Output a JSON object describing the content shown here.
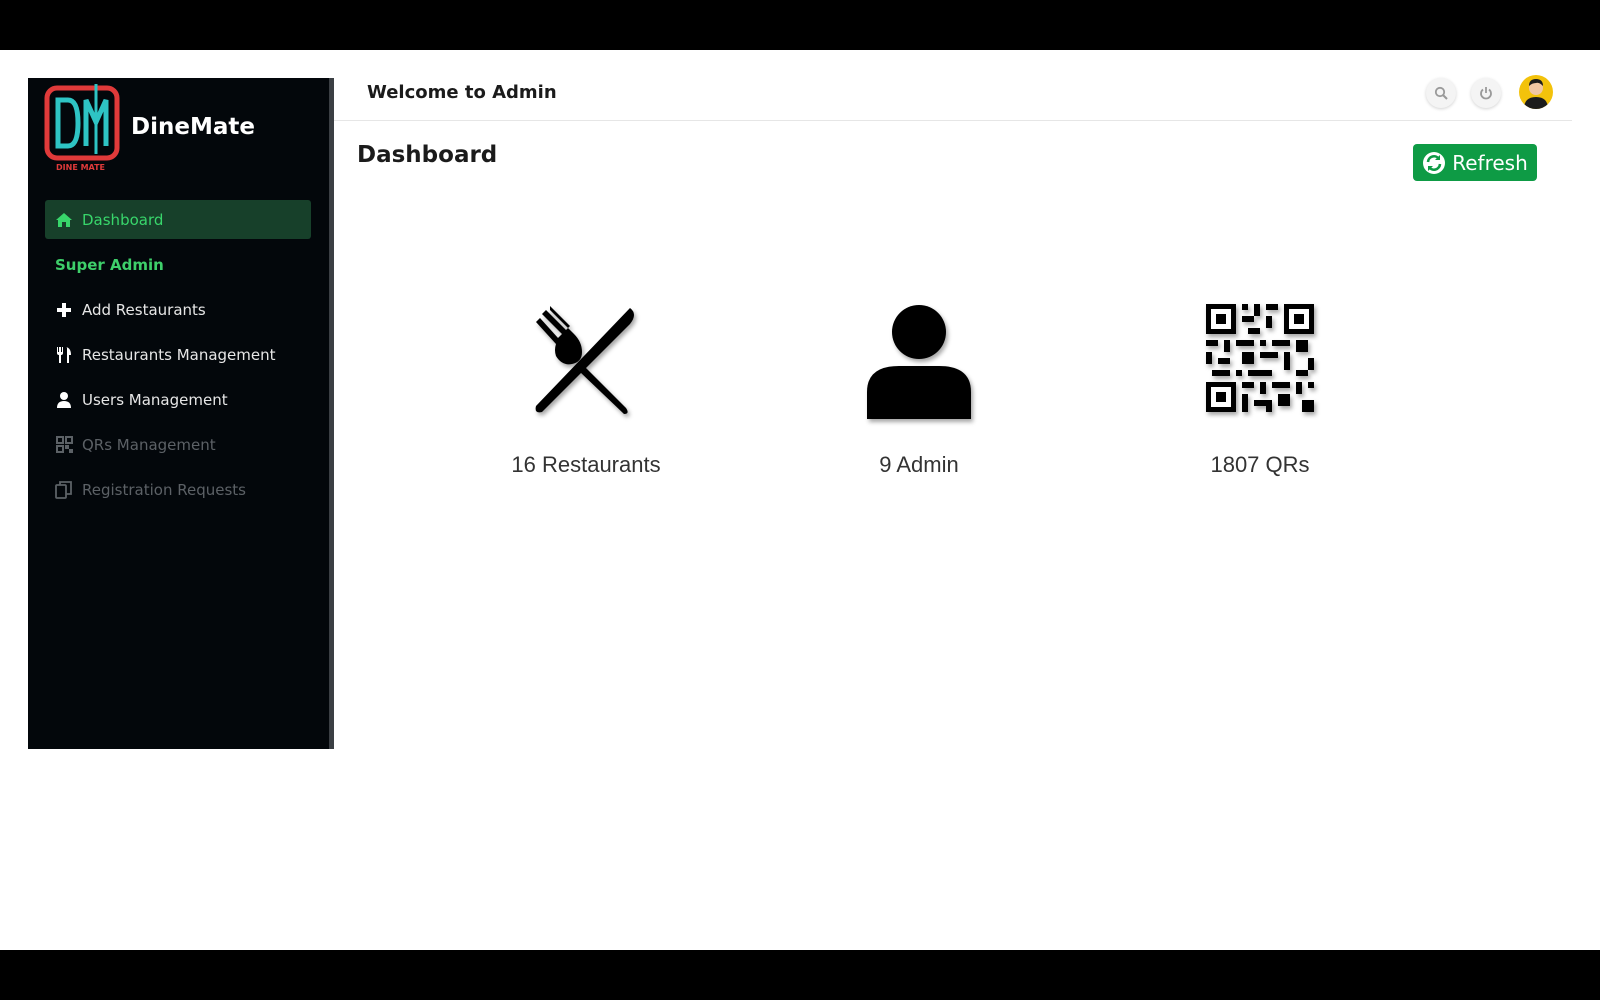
{
  "brand": {
    "name": "DineMate",
    "logo_caption": "DINE MATE",
    "logo_letters": "DM"
  },
  "colors": {
    "sidebar_bg": "#03070b",
    "accent_green": "#0e9b45",
    "active_text": "#38d66b",
    "logo_red": "#e03a3a",
    "logo_teal": "#2ec4c4"
  },
  "sidebar": {
    "items": [
      {
        "label": "Dashboard",
        "icon": "home-icon",
        "state": "active"
      },
      {
        "label": "Super Admin",
        "icon": "",
        "state": "section-header"
      },
      {
        "label": "Add Restaurants",
        "icon": "plus-icon",
        "state": "normal"
      },
      {
        "label": "Restaurants Management",
        "icon": "utensils-icon",
        "state": "normal"
      },
      {
        "label": "Users Management",
        "icon": "user-icon",
        "state": "normal"
      },
      {
        "label": "QRs Management",
        "icon": "qr-icon",
        "state": "disabled"
      },
      {
        "label": "Registration Requests",
        "icon": "copy-icon",
        "state": "disabled"
      }
    ]
  },
  "header": {
    "welcome": "Welcome to Admin",
    "actions": [
      "search-icon",
      "power-icon",
      "user-avatar"
    ]
  },
  "main": {
    "title": "Dashboard",
    "refresh_label": "Refresh",
    "stats": [
      {
        "label": "16 Restaurants",
        "icon": "fork-knife-icon"
      },
      {
        "label": "9 Admin",
        "icon": "person-icon"
      },
      {
        "label": "1807 QRs",
        "icon": "qr-code-icon"
      }
    ]
  }
}
